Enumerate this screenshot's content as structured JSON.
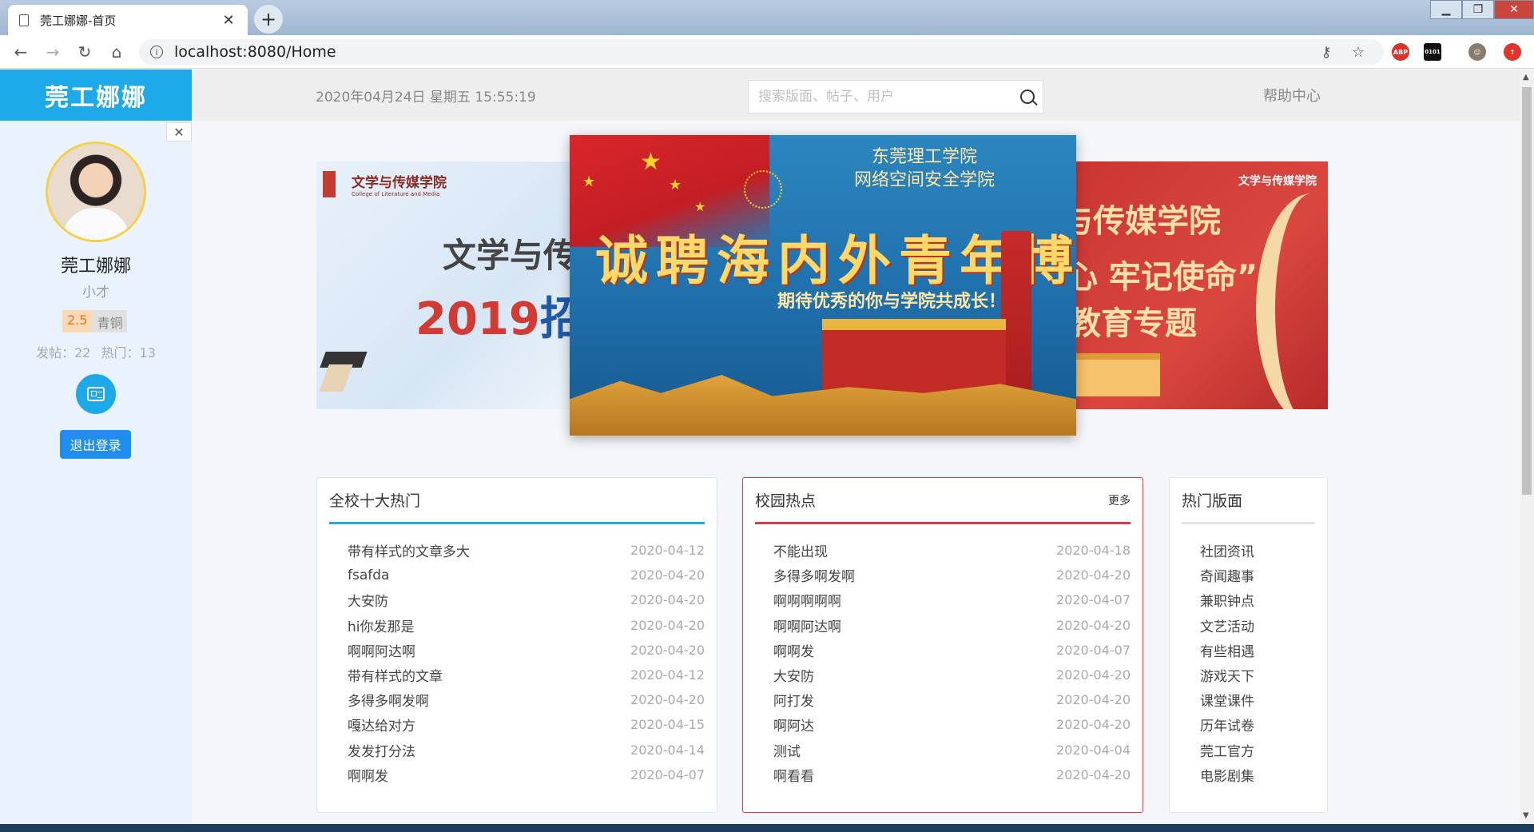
{
  "browser": {
    "tab_title": "莞工娜娜-首页",
    "url": "localhost:8080/Home"
  },
  "sidebar": {
    "logo": "莞工娜娜",
    "username": "莞工娜娜",
    "title": "小才",
    "level_num": "2.5",
    "level_rank": "青铜",
    "posts_label": "发帖：22",
    "hot_label": "热门：13",
    "logout_label": "退出登录"
  },
  "topbar": {
    "datetime": "2020年04月24日 星期五 15:55:19",
    "search_placeholder": "搜索版面、帖子、用户",
    "help": "帮助中心"
  },
  "carousel": {
    "left": {
      "brand": "文学与传媒学院",
      "brand_en": "College of Literature and Media",
      "main": "文学与传媒学",
      "year": "2019",
      "text": "招生"
    },
    "center": {
      "school_line1": "东莞理工学院",
      "school_line2": "网络空间安全学院",
      "main": "诚聘海内外青年博士",
      "sub": "期待优秀的你与学院共成长！"
    },
    "right": {
      "brand": "文学与传媒学院",
      "line1": "学与传媒学院",
      "line2": "初心 牢记使命”",
      "line3": "题教育专题"
    }
  },
  "panels": {
    "hot": {
      "title": "全校十大热门",
      "items": [
        {
          "title": "带有样式的文章多大",
          "date": "2020-04-12"
        },
        {
          "title": "fsafda",
          "date": "2020-04-20"
        },
        {
          "title": "大安防",
          "date": "2020-04-20"
        },
        {
          "title": "hi你发那是",
          "date": "2020-04-20"
        },
        {
          "title": "啊啊阿达啊",
          "date": "2020-04-20"
        },
        {
          "title": "带有样式的文章",
          "date": "2020-04-12"
        },
        {
          "title": "多得多啊发啊",
          "date": "2020-04-20"
        },
        {
          "title": "嘎达给对方",
          "date": "2020-04-15"
        },
        {
          "title": "发发打分法",
          "date": "2020-04-14"
        },
        {
          "title": "啊啊发",
          "date": "2020-04-07"
        }
      ]
    },
    "campus": {
      "title": "校园热点",
      "more": "更多",
      "items": [
        {
          "title": "不能出现",
          "date": "2020-04-18"
        },
        {
          "title": "多得多啊发啊",
          "date": "2020-04-20"
        },
        {
          "title": "啊啊啊啊啊",
          "date": "2020-04-07"
        },
        {
          "title": "啊啊阿达啊",
          "date": "2020-04-20"
        },
        {
          "title": "啊啊发",
          "date": "2020-04-07"
        },
        {
          "title": "大安防",
          "date": "2020-04-20"
        },
        {
          "title": "阿打发",
          "date": "2020-04-20"
        },
        {
          "title": "啊阿达",
          "date": "2020-04-20"
        },
        {
          "title": "测试",
          "date": "2020-04-04"
        },
        {
          "title": "啊看看",
          "date": "2020-04-20"
        }
      ]
    },
    "boards": {
      "title": "热门版面",
      "items": [
        "社团资讯",
        "奇闻趣事",
        "兼职钟点",
        "文艺活动",
        "有些相遇",
        "游戏天下",
        "课堂课件",
        "历年试卷",
        "莞工官方",
        "电影剧集"
      ]
    }
  },
  "colors": {
    "accent": "#1ea9e8",
    "campus_red": "#e3383d",
    "logout_blue": "#1f8eee"
  }
}
